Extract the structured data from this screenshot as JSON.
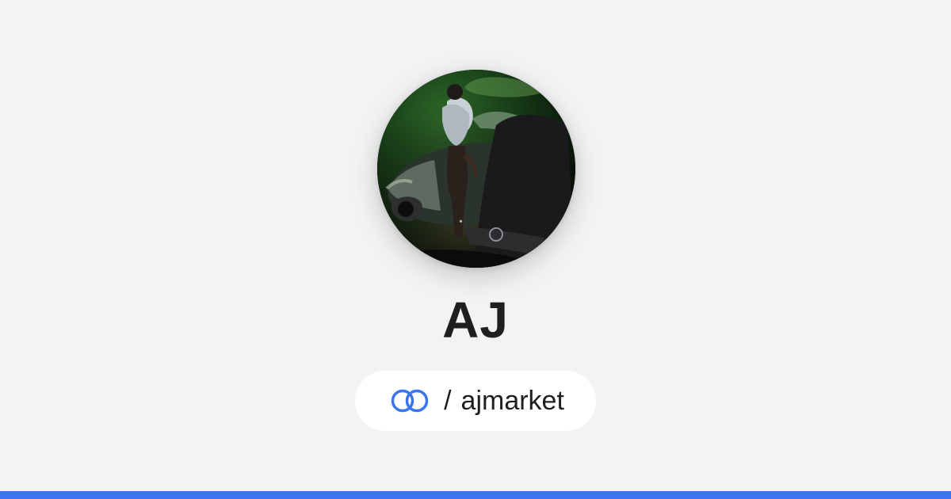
{
  "profile": {
    "name": "AJ",
    "separator": "/",
    "username": "ajmarket",
    "avatar_alt": "Profile photo"
  },
  "theme": {
    "background": "#f3f3f5",
    "pill_background": "#ffffff",
    "text": "#1f1f22",
    "accent": "#3b73f0"
  },
  "icons": {
    "brand": "linked-rings-icon"
  }
}
